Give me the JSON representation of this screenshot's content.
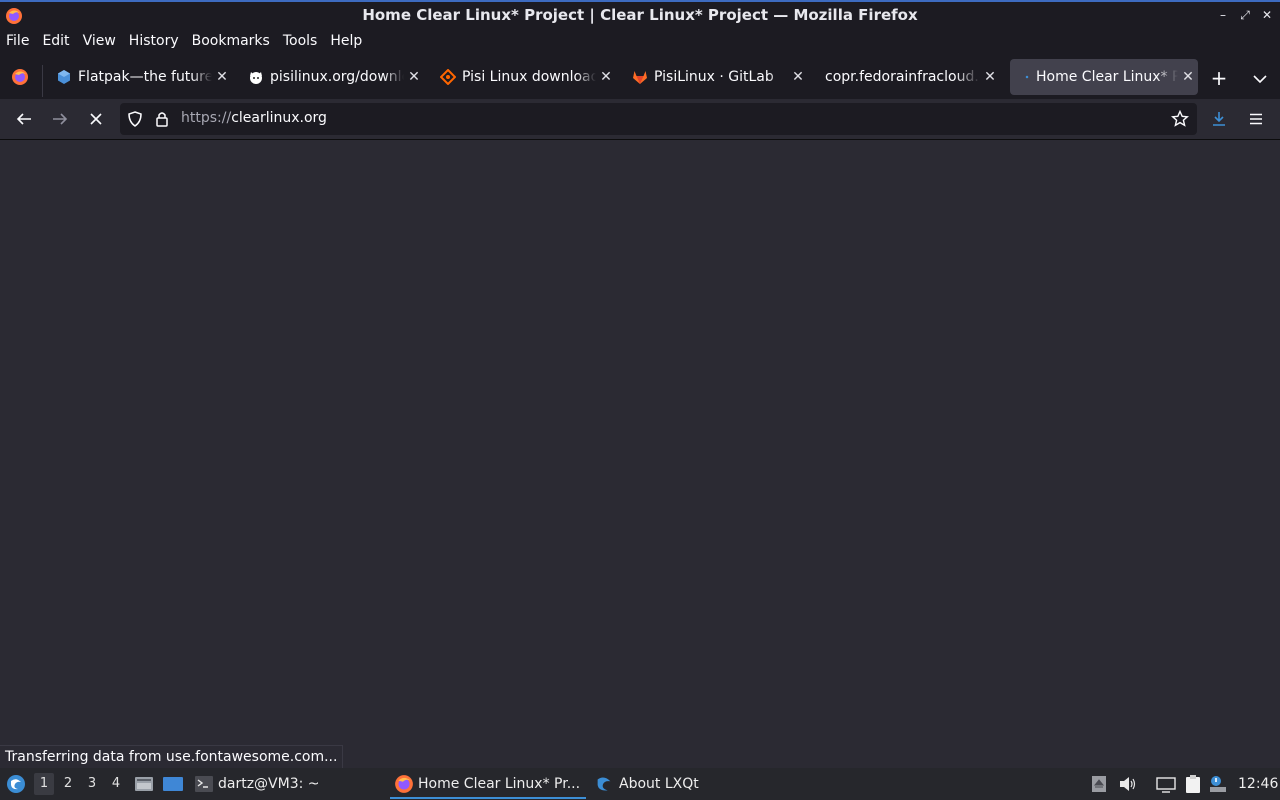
{
  "window": {
    "title": "Home Clear Linux* Project | Clear Linux* Project — Mozilla Firefox"
  },
  "menubar": {
    "items": [
      "File",
      "Edit",
      "View",
      "History",
      "Bookmarks",
      "Tools",
      "Help"
    ]
  },
  "tabs": [
    {
      "label": "Flatpak—the future of",
      "icon": "flatpak-icon"
    },
    {
      "label": "pisilinux.org/downloads",
      "icon": "pisi-cat-icon"
    },
    {
      "label": "Pisi Linux download",
      "icon": "sourceforge-icon"
    },
    {
      "label": "PisiLinux · GitLab",
      "icon": "gitlab-icon"
    },
    {
      "label": "copr.fedorainfracloud.org",
      "icon": "none"
    },
    {
      "label": "Home Clear Linux* Project",
      "icon": "loading-dot-icon",
      "active": true
    }
  ],
  "navbar": {
    "url_protocol": "https://",
    "url_host": "clearlinux.org"
  },
  "status": {
    "text": "Transferring data from use.fontawesome.com..."
  },
  "taskbar": {
    "desktops": [
      "1",
      "2",
      "3",
      "4"
    ],
    "active_desktop": "1",
    "terminal_label": "dartz@VM3: ~",
    "tasks": [
      {
        "label": "Home Clear Linux* Pr...",
        "icon": "firefox-icon",
        "active": true
      },
      {
        "label": "About LXQt",
        "icon": "lxqt-icon",
        "active": false
      }
    ],
    "clock": "12:46"
  },
  "colors": {
    "accent": "#3d8fd6",
    "chrome_bg": "#1c1b22",
    "content_bg": "#2b2a33"
  }
}
